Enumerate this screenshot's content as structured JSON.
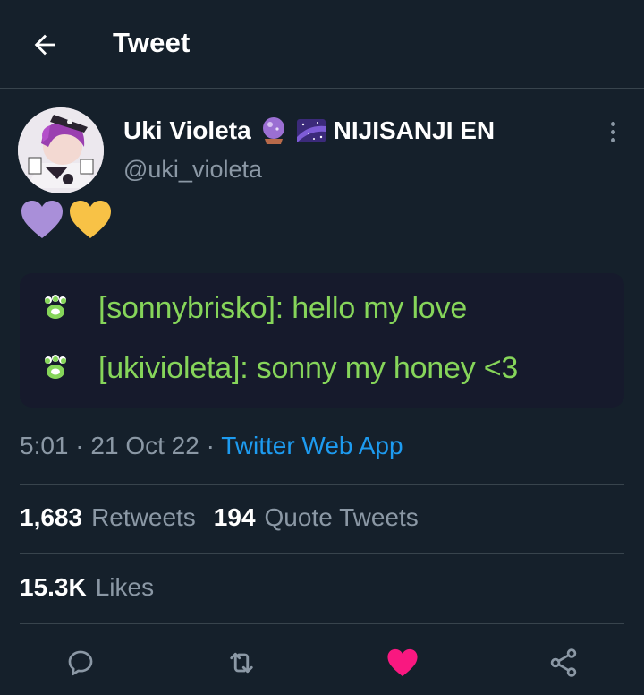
{
  "header": {
    "title": "Tweet",
    "back_icon": "arrow-left-icon"
  },
  "author": {
    "display_name": "Uki Violeta",
    "name_emojis": [
      "crystal-ball-emoji",
      "milky-way-emoji"
    ],
    "affiliation": "NIJISANJI EN",
    "handle": "@uki_violeta"
  },
  "tweet": {
    "heart_emojis": [
      "purple-heart",
      "yellow-heart"
    ],
    "chat_lines": [
      {
        "text": "[sonnybrisko]: hello my love",
        "icon": "paw-prints-icon"
      },
      {
        "text": "[ukivioleta]: sonny my honey <3",
        "icon": "paw-prints-icon"
      }
    ],
    "time": "5:01",
    "sep1": " · ",
    "date": "21 Oct 22",
    "sep2": " · ",
    "source": "Twitter Web App"
  },
  "stats": {
    "retweets_count": "1,683",
    "retweets_label": "Retweets",
    "quotes_count": "194",
    "quotes_label": "Quote Tweets",
    "likes_count": "15.3K",
    "likes_label": "Likes"
  },
  "actions": [
    "reply-icon",
    "retweet-icon",
    "like-icon",
    "share-icon"
  ],
  "colors": {
    "background": "#15202b",
    "divider": "#38444d",
    "secondary_text": "#8b98a5",
    "link": "#1d9bf0",
    "like_active": "#f91880",
    "chat_green": "#86d55a",
    "chat_background": "#161a2c"
  }
}
